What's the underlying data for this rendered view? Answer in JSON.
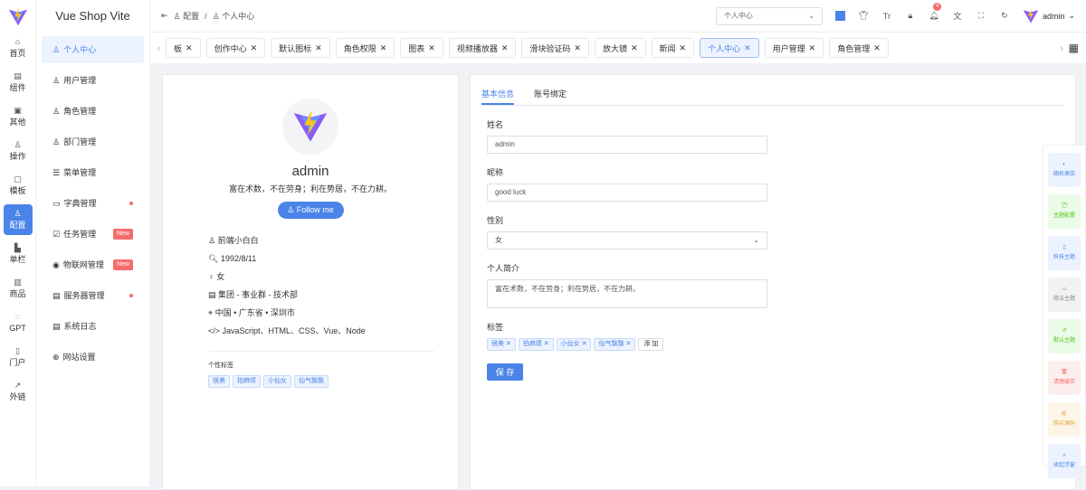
{
  "brand": "Vue Shop Vite",
  "rail": [
    "首页",
    "组件",
    "其他",
    "操作",
    "模板",
    "配置",
    "单栏",
    "商品",
    "GPT",
    "门户",
    "外链"
  ],
  "menu": [
    {
      "label": "个人中心"
    },
    {
      "label": "用户管理"
    },
    {
      "label": "角色管理"
    },
    {
      "label": "部门管理"
    },
    {
      "label": "菜单管理"
    },
    {
      "label": "字典管理",
      "dot": true
    },
    {
      "label": "任务管理",
      "badge": "New"
    },
    {
      "label": "物联网管理",
      "badge": "New"
    },
    {
      "label": "服务器管理",
      "dot": true
    },
    {
      "label": "系统日志"
    },
    {
      "label": "网站设置"
    }
  ],
  "breadcrumb": [
    "配置",
    "个人中心"
  ],
  "header": {
    "search": "个人中心",
    "notifications": "4",
    "user": "admin"
  },
  "tabs": [
    "板",
    "创作中心",
    "默认图标",
    "角色权限",
    "图表",
    "视频播放器",
    "滑块验证码",
    "放大镜",
    "新闻",
    "个人中心",
    "用户管理",
    "角色管理"
  ],
  "profile": {
    "name": "admin",
    "motto": "富在术数，不在劳身；利在势居，不在力耕。",
    "follow": "Follow me",
    "info": [
      "前端小白白",
      "1992/8/11",
      "女",
      "集团 - 事业群 - 技术部",
      "中国 • 广东省 • 深圳市",
      "JavaScript、HTML、CSS、Vue、Node"
    ],
    "tags_title": "个性标签",
    "tags": [
      "很美",
      "拍麻烦",
      "小仙女",
      "仙气飘飘"
    ]
  },
  "form": {
    "tabs": [
      "基本信息",
      "账号绑定"
    ],
    "name_label": "姓名",
    "name": "admin",
    "nick_label": "昵称",
    "nick": "good luck",
    "sex_label": "性别",
    "sex": "女",
    "bio_label": "个人简介",
    "bio": "富在术数，不在劳身；利在势居，不在力耕。",
    "tags_label": "标签",
    "tags": [
      "很美",
      "拍麻烦",
      "小仙女",
      "仙气飘飘"
    ],
    "add_tag": "添 加",
    "save": "保 存"
  },
  "float": [
    {
      "label": "随机换肤",
      "color": "#4a84e8",
      "bg": "#ecf3fe"
    },
    {
      "label": "主题配置",
      "color": "#52c41a",
      "bg": "#eafbe7"
    },
    {
      "label": "科技主题",
      "color": "#4a84e8",
      "bg": "#ecf3fe"
    },
    {
      "label": "简洁主题",
      "color": "#888",
      "bg": "#f2f2f2"
    },
    {
      "label": "默认主题",
      "color": "#52c41a",
      "bg": "#eafbe7"
    },
    {
      "label": "清理缓存",
      "color": "#f56c6c",
      "bg": "#fdeeee"
    },
    {
      "label": "购买源码",
      "color": "#e6a23c",
      "bg": "#fdf6e8"
    },
    {
      "label": "收起浮窗",
      "color": "#4a84e8",
      "bg": "#ecf3fe"
    }
  ]
}
